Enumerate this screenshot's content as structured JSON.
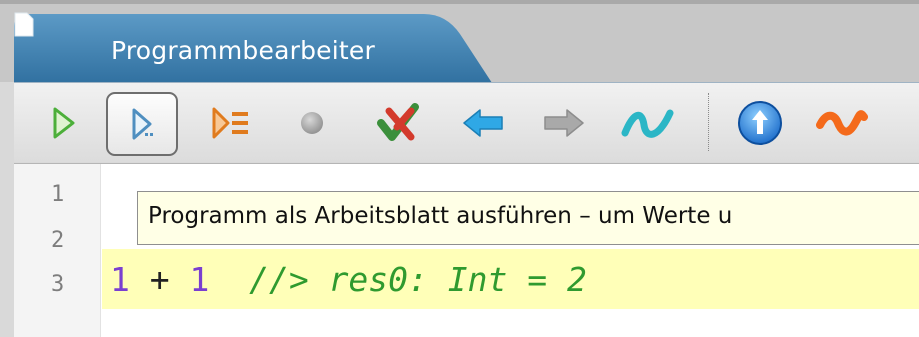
{
  "tab": {
    "title": "Programmbearbeiter",
    "icon": "document-icon"
  },
  "toolbar": {
    "buttons": [
      {
        "name": "run-button",
        "icon": "play-icon"
      },
      {
        "name": "run-worksheet-button",
        "icon": "worksheet-play-icon",
        "pressed": true
      },
      {
        "name": "run-step-list-button",
        "icon": "step-list-icon"
      },
      {
        "name": "stop-button",
        "icon": "stop-dot-icon"
      },
      {
        "name": "clear-button",
        "icon": "check-cross-icon"
      },
      {
        "name": "back-button",
        "icon": "arrow-left-icon"
      },
      {
        "name": "forward-button",
        "icon": "arrow-right-icon"
      },
      {
        "name": "wave-button",
        "icon": "wave-icon"
      },
      {
        "name": "upload-button",
        "icon": "circle-arrow-up-icon"
      },
      {
        "name": "squiggle-button",
        "icon": "squiggle-icon"
      }
    ]
  },
  "editor": {
    "line_numbers": [
      "1",
      "2",
      "3"
    ],
    "code": {
      "a": "1",
      "plus": " + ",
      "b": "1",
      "comment": "  //> res0: Int = 2"
    }
  },
  "tooltip": {
    "text": "Programm als Arbeitsblatt ausführen – um Werte u"
  },
  "colors": {
    "tab_blue": "#3d7fae",
    "highlight": "#ffffb8",
    "number": "#7a3fd0",
    "comment": "#2f9a2f"
  }
}
